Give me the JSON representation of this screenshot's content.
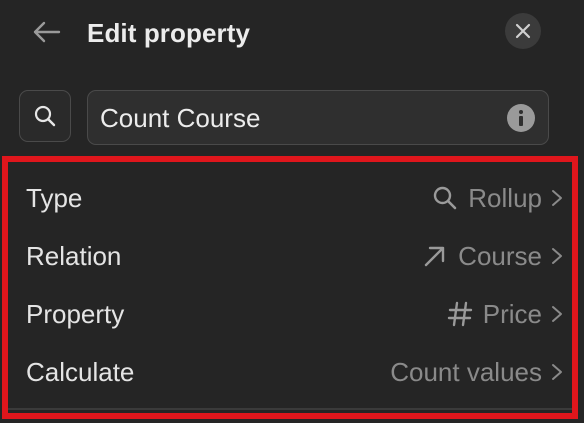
{
  "header": {
    "title": "Edit property"
  },
  "name_field": {
    "value": "Count Course"
  },
  "rows": [
    {
      "label": "Type",
      "value": "Rollup",
      "icon": "search-icon"
    },
    {
      "label": "Relation",
      "value": "Course",
      "icon": "arrow-up-right-icon"
    },
    {
      "label": "Property",
      "value": "Price",
      "icon": "hash-icon"
    },
    {
      "label": "Calculate",
      "value": "Count values",
      "icon": ""
    }
  ],
  "colors": {
    "background": "#252525",
    "highlight": "#e0161c",
    "muted_text": "#8a8a8a"
  }
}
